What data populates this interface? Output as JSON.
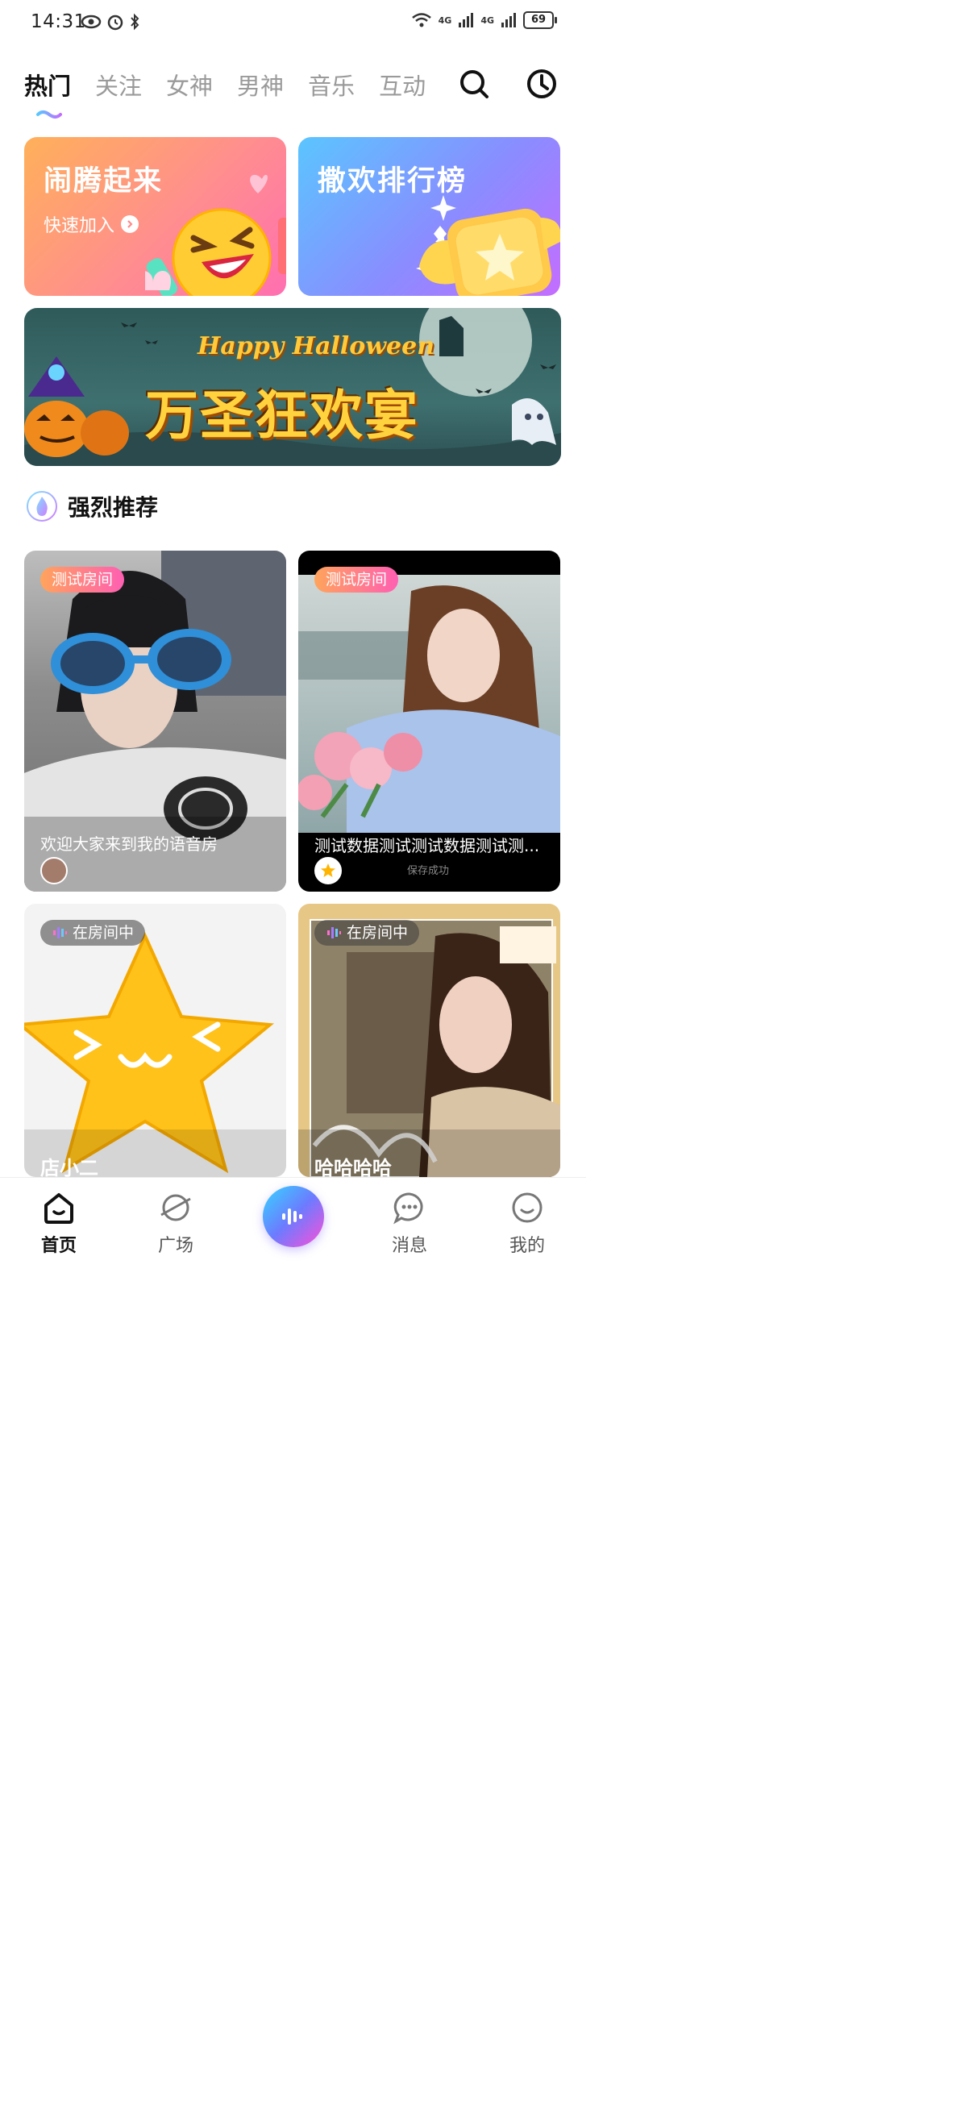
{
  "status_bar": {
    "time": "14:31",
    "battery": "69",
    "net1": "4G",
    "net2": "4G"
  },
  "tabs": [
    {
      "label": "热门",
      "active": true
    },
    {
      "label": "关注"
    },
    {
      "label": "女神"
    },
    {
      "label": "男神"
    },
    {
      "label": "音乐"
    },
    {
      "label": "互动"
    }
  ],
  "feature_cards": [
    {
      "title": "闹腾起来",
      "subtitle": "快速加入"
    },
    {
      "title": "撒欢排行榜"
    }
  ],
  "banner": {
    "line1": "Happy Halloween",
    "line2": "万圣狂欢宴"
  },
  "section": {
    "title": "强烈推荐"
  },
  "rooms": [
    {
      "badge": "测试房间",
      "title": "欢迎大家来到我的语音房"
    },
    {
      "badge": "测试房间",
      "title": "测试数据测试测试数据测试测...",
      "toast": "保存成功"
    },
    {
      "badge": "在房间中",
      "title": "店小二"
    },
    {
      "badge": "在房间中",
      "title": "哈哈哈哈"
    }
  ],
  "bottom_nav": [
    {
      "label": "首页",
      "active": true
    },
    {
      "label": "广场"
    },
    {
      "label": "消息"
    },
    {
      "label": "我的"
    }
  ],
  "colors": {
    "accent": "#8a6cff",
    "badge_pink": "#ff5fb2",
    "badge_orange": "#ffa45c"
  }
}
